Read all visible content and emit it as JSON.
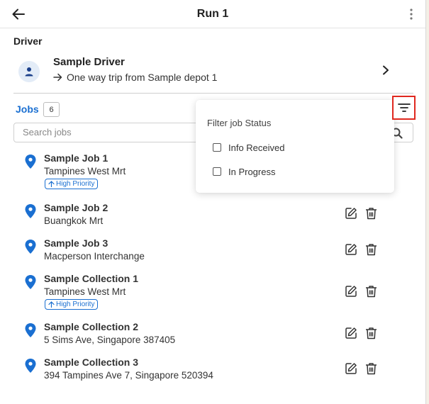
{
  "header": {
    "title": "Run 1"
  },
  "driver_section": {
    "label": "Driver",
    "name": "Sample Driver",
    "trip": "One way trip from Sample depot 1"
  },
  "jobs_section": {
    "tab_label": "Jobs",
    "count": "6",
    "search_placeholder": "Search jobs"
  },
  "jobs": [
    {
      "title": "Sample Job 1",
      "address": "Tampines West Mrt",
      "priority": "High Priority"
    },
    {
      "title": "Sample Job 2",
      "address": "Buangkok Mrt"
    },
    {
      "title": "Sample Job 3",
      "address": "Macperson Interchange"
    },
    {
      "title": "Sample Collection 1",
      "address": "Tampines West Mrt",
      "priority": "High Priority"
    },
    {
      "title": "Sample Collection 2",
      "address": "5 Sims Ave, Singapore 387405"
    },
    {
      "title": "Sample Collection 3",
      "address": "394 Tampines Ave 7, Singapore 520394"
    }
  ],
  "filter_menu": {
    "title": "Filter job Status",
    "options": [
      {
        "label": "Info Received",
        "checked": false
      },
      {
        "label": "In Progress",
        "checked": false
      }
    ]
  },
  "colors": {
    "accent": "#1a6fd1",
    "pin": "#1a6fd1",
    "highlight_border": "#e0281f"
  },
  "icons": {
    "back": "arrow-left-icon",
    "more": "kebab-menu-icon",
    "driver": "person-icon",
    "chevron": "chevron-right-icon",
    "filter": "filter-lines-icon",
    "search": "search-icon",
    "pin": "map-pin-icon",
    "edit": "edit-icon",
    "delete": "trash-icon"
  }
}
